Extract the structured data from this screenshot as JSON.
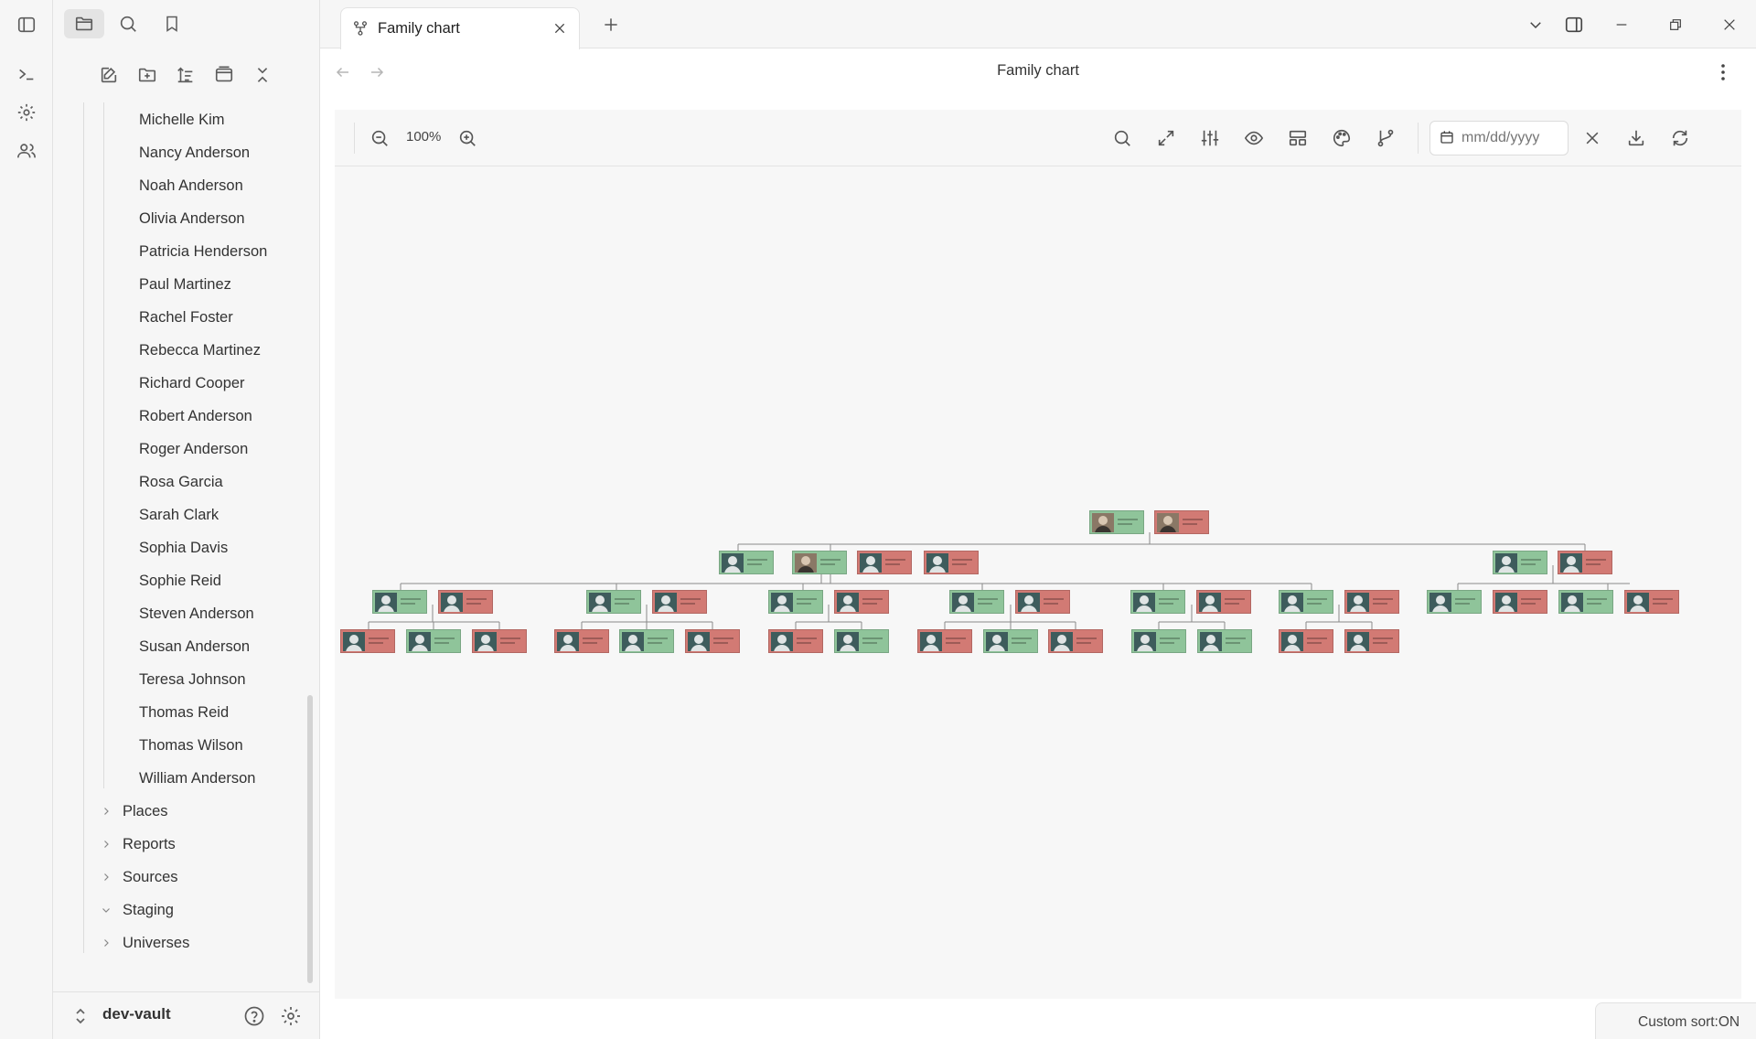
{
  "window": {
    "tab_title": "Family chart"
  },
  "view": {
    "title": "Family chart"
  },
  "zoom": {
    "level": "100%"
  },
  "date_filter": {
    "placeholder": "mm/dd/yyyy"
  },
  "sidebar": {
    "people": [
      "Michelle Kim",
      "Nancy Anderson",
      "Noah Anderson",
      "Olivia Anderson",
      "Patricia Henderson",
      "Paul Martinez",
      "Rachel Foster",
      "Rebecca Martinez",
      "Richard Cooper",
      "Robert Anderson",
      "Roger Anderson",
      "Rosa Garcia",
      "Sarah Clark",
      "Sophia Davis",
      "Sophie Reid",
      "Steven Anderson",
      "Susan Anderson",
      "Teresa Johnson",
      "Thomas Reid",
      "Thomas Wilson",
      "William Anderson"
    ],
    "folders": [
      {
        "label": "Places",
        "expanded": false
      },
      {
        "label": "Reports",
        "expanded": false
      },
      {
        "label": "Sources",
        "expanded": false
      },
      {
        "label": "Staging",
        "expanded": true
      },
      {
        "label": "Universes",
        "expanded": false
      }
    ],
    "vault_name": "dev-vault"
  },
  "status": {
    "text": "Custom sort:ON"
  },
  "colors": {
    "male_card": "#8fc49a",
    "female_card": "#d27a74",
    "avatar_bg": "#3e5c5c",
    "canvas_bg": "#f7f7f7"
  },
  "icons": {
    "ribbon": [
      "sidebar-toggle-icon",
      "terminal-icon",
      "gear-icon",
      "people-icon"
    ],
    "toolbar": [
      "zoom-out-icon",
      "zoom-in-icon",
      "search-icon",
      "expand-icon",
      "sliders-icon",
      "eye-icon",
      "layout-icon",
      "palette-icon",
      "branch-icon",
      "clear-icon",
      "download-icon",
      "refresh-icon"
    ]
  }
}
